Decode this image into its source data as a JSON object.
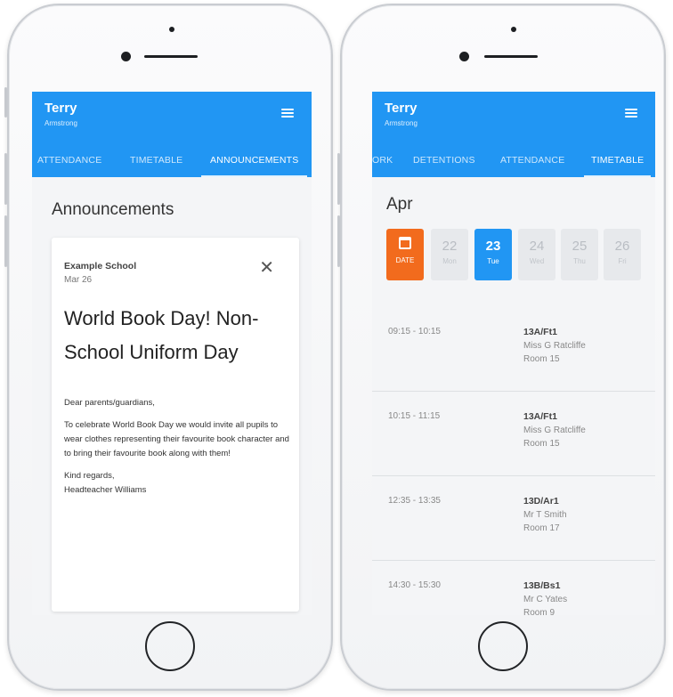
{
  "colors": {
    "primary": "#2196f3",
    "date_button": "#f26b1d",
    "background": "#f4f5f7"
  },
  "left_phone": {
    "user": {
      "first_name": "Terry",
      "last_name": "Armstrong"
    },
    "menu_icon": "hamburger-menu-icon",
    "tabs": [
      {
        "label": "ATTENDANCE",
        "active": false
      },
      {
        "label": "TIMETABLE",
        "active": false
      },
      {
        "label": "ANNOUNCEMENTS",
        "active": true
      }
    ],
    "section_title": "Announcements",
    "announcement": {
      "school": "Example School",
      "date": "Mar 26",
      "close_icon": "close-icon",
      "title": "World Book Day! Non-School Uniform Day",
      "greeting": "Dear parents/guardians,",
      "body": "To celebrate World Book Day we would invite all pupils to wear clothes representing their favourite book character and to bring their favourite book along with them!",
      "signoff": "Kind regards,",
      "signature": "Headteacher Williams"
    }
  },
  "right_phone": {
    "user": {
      "first_name": "Terry",
      "last_name": "Armstrong"
    },
    "menu_icon": "hamburger-menu-icon",
    "tabs": [
      {
        "label": "ORK",
        "active": false
      },
      {
        "label": "DETENTIONS",
        "active": false
      },
      {
        "label": "ATTENDANCE",
        "active": false
      },
      {
        "label": "TIMETABLE",
        "active": true
      }
    ],
    "month": "Apr",
    "date_picker": {
      "icon": "calendar-icon",
      "label": "DATE"
    },
    "days": [
      {
        "num": "22",
        "dow": "Mon",
        "selected": false
      },
      {
        "num": "23",
        "dow": "Tue",
        "selected": true
      },
      {
        "num": "24",
        "dow": "Wed",
        "selected": false
      },
      {
        "num": "25",
        "dow": "Thu",
        "selected": false
      },
      {
        "num": "26",
        "dow": "Fri",
        "selected": false
      }
    ],
    "lessons": [
      {
        "time": "09:15 - 10:15",
        "class": "13A/Ft1",
        "teacher": "Miss G Ratcliffe",
        "room": "Room 15"
      },
      {
        "time": "10:15 - 11:15",
        "class": "13A/Ft1",
        "teacher": "Miss G Ratcliffe",
        "room": "Room 15"
      },
      {
        "time": "12:35 - 13:35",
        "class": "13D/Ar1",
        "teacher": "Mr T Smith",
        "room": "Room 17"
      },
      {
        "time": "14:30 - 15:30",
        "class": "13B/Bs1",
        "teacher": "Mr C Yates",
        "room": "Room 9"
      }
    ]
  }
}
